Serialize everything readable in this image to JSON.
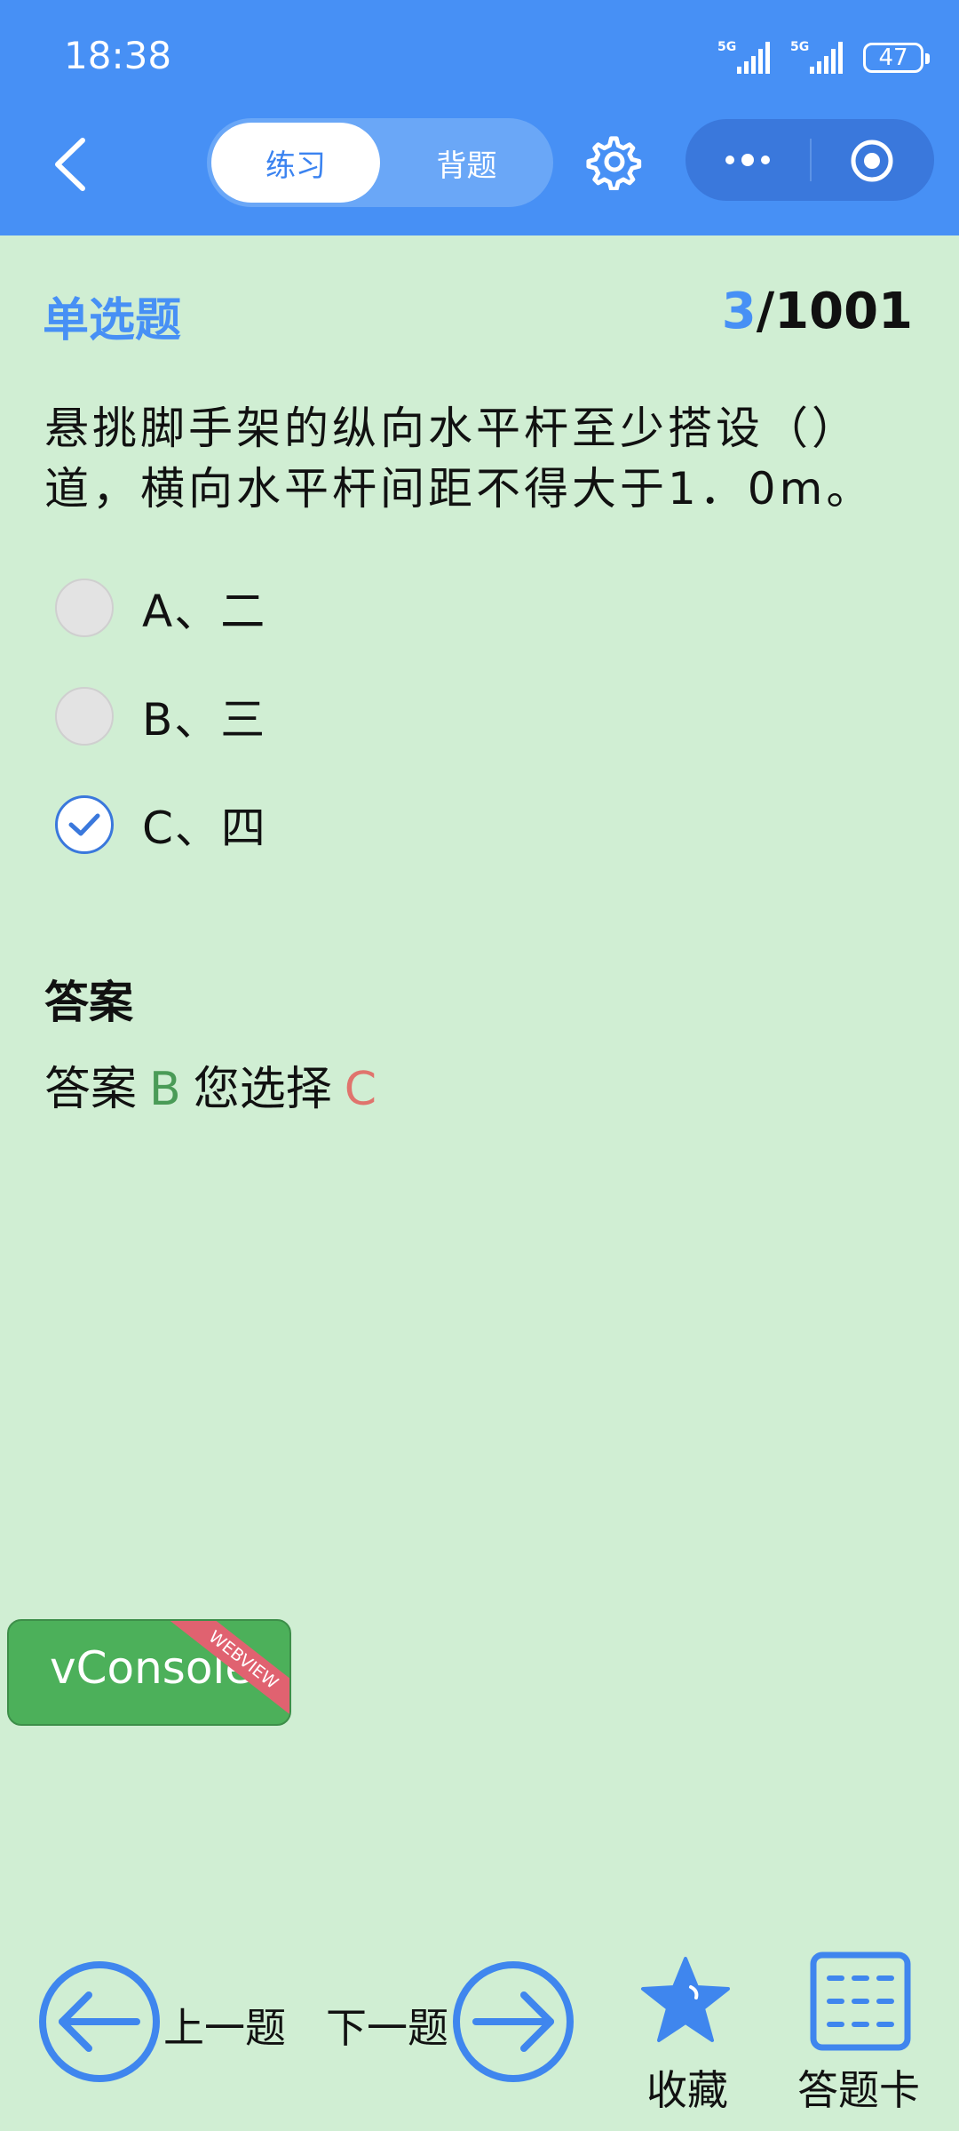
{
  "status": {
    "time": "18:38",
    "signal1": "5G",
    "signal2": "5G",
    "battery": "47"
  },
  "header": {
    "tabs": [
      {
        "label": "练习",
        "active": true
      },
      {
        "label": "背题",
        "active": false
      }
    ],
    "icons": [
      "back-icon",
      "gear-icon",
      "more-icon",
      "target-icon"
    ]
  },
  "question": {
    "type": "单选题",
    "current": "3",
    "total": "/1001",
    "text": "悬挑脚手架的纵向水平杆至少搭设（）道，横向水平杆间距不得大于1．0m。",
    "options": [
      {
        "label": "A、二",
        "checked": false
      },
      {
        "label": "B、三",
        "checked": false
      },
      {
        "label": "C、四",
        "checked": true
      }
    ]
  },
  "answer": {
    "title": "答案",
    "prefix": "答案",
    "correct": "B",
    "chosen_prefix": "您选择",
    "chosen": "C"
  },
  "vconsole": {
    "label": "vConsole",
    "ribbon": "WEBVIEW",
    "color": "#4cb05a"
  },
  "bottom": {
    "prev": "上一题",
    "next": "下一题",
    "favorite": "收藏",
    "card": "答题卡"
  },
  "colors": {
    "accent": "#4790f5",
    "background": "#d0eed3",
    "correct": "#4a9b57",
    "wrong": "#e0746d"
  }
}
